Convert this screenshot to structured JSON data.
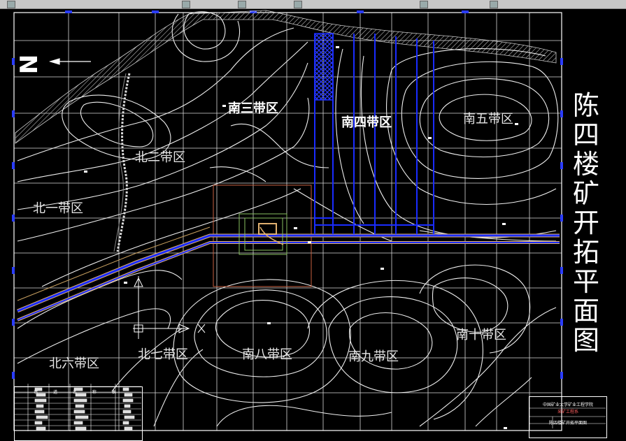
{
  "title_chars": [
    "陈",
    "四",
    "楼",
    "矿",
    "开",
    "拓",
    "平",
    "面",
    "图"
  ],
  "north_label": "N",
  "zones": [
    {
      "id": "nan-san",
      "text": "南三带区",
      "style": "bold"
    },
    {
      "id": "nan-si",
      "text": "南四带区",
      "style": "bold"
    },
    {
      "id": "nan-wu",
      "text": "南五带区",
      "style": "white"
    },
    {
      "id": "bei-er",
      "text": "北二带区",
      "style": "white"
    },
    {
      "id": "bei-yi",
      "text": "北一带区",
      "style": "white"
    },
    {
      "id": "nan-shi",
      "text": "南十带区",
      "style": "white"
    },
    {
      "id": "bei-liu",
      "text": "北六带区",
      "style": "white"
    },
    {
      "id": "bei-qi",
      "text": "北七带区",
      "style": "white"
    },
    {
      "id": "nan-ba",
      "text": "南八带区",
      "style": "white"
    },
    {
      "id": "nan-jiu",
      "text": "南九带区",
      "style": "white"
    }
  ],
  "legend": {
    "title": "巷 道 名 称 表"
  },
  "title_block": {
    "school": "中国矿业大学矿业工程学院",
    "dept": "采矿工程系",
    "drawing": "陈四楼矿开拓平面图"
  },
  "colors": {
    "background": "#000000",
    "grid": "#ffffff",
    "contour": "#ffffff",
    "roadway": "#1a2cff",
    "roadway_outline": "#e0b070",
    "boundary": "#c87050",
    "hatch": "#bbbbbb",
    "shaft_box": "#88c060"
  }
}
